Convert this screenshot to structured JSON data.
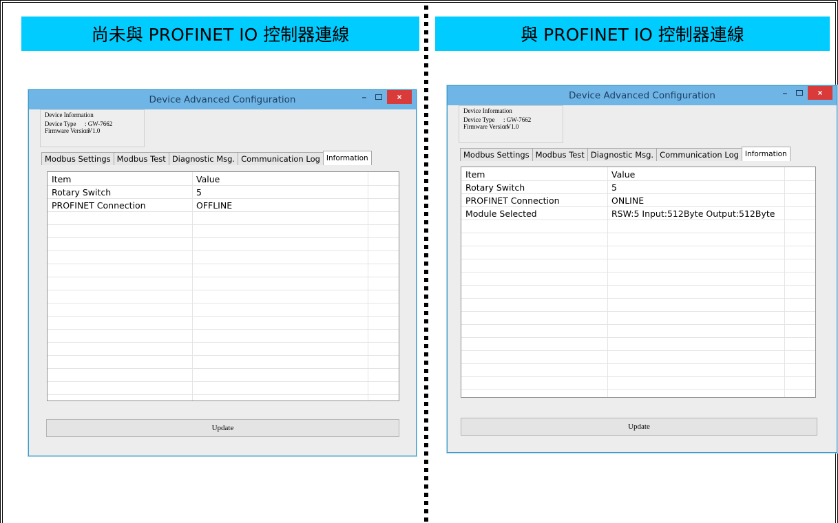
{
  "colors": {
    "banner": "#00ccff",
    "titlebar": "#6fb6e6",
    "close": "#d93a3a"
  },
  "left": {
    "banner": "尚未與 PROFINET IO 控制器連線",
    "window": {
      "title": "Device Advanced Configuration",
      "minimize": "–",
      "close": "×",
      "device_info": {
        "legend": "Device Information",
        "type_label": "Device Type",
        "type_value": ": GW-7662",
        "fw_label": "Firmware Version",
        "fw_value": ": V1.0"
      },
      "tabs": [
        "Modbus Settings",
        "Modbus Test",
        "Diagnostic Msg.",
        "Communication Log",
        "Information"
      ],
      "active_tab": "Information",
      "table": {
        "headers": [
          "Item",
          "Value"
        ],
        "rows": [
          [
            "Rotary Switch",
            "5"
          ],
          [
            "PROFINET Connection",
            "OFFLINE"
          ]
        ]
      },
      "update": "Update"
    }
  },
  "right": {
    "banner": "與 PROFINET IO 控制器連線",
    "window": {
      "title": "Device Advanced Configuration",
      "minimize": "–",
      "close": "×",
      "device_info": {
        "legend": "Device Information",
        "type_label": "Device Type",
        "type_value": ": GW-7662",
        "fw_label": "Firmware Version",
        "fw_value": ": V1.0"
      },
      "tabs": [
        "Modbus Settings",
        "Modbus Test",
        "Diagnostic Msg.",
        "Communication Log",
        "Information"
      ],
      "active_tab": "Information",
      "table": {
        "headers": [
          "Item",
          "Value"
        ],
        "rows": [
          [
            "Rotary Switch",
            "5"
          ],
          [
            "PROFINET Connection",
            "ONLINE"
          ],
          [
            "Module Selected",
            "RSW:5 Input:512Byte Output:512Byte"
          ]
        ]
      },
      "update": "Update"
    }
  }
}
